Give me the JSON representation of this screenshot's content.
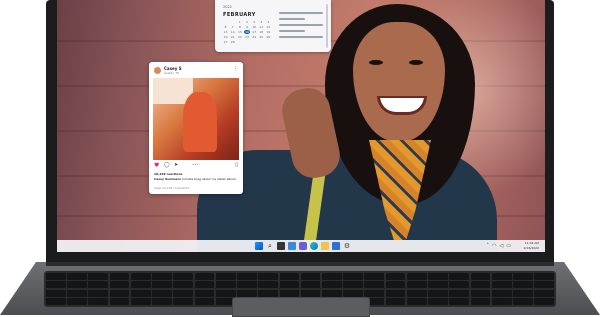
{
  "calendar_widget": {
    "year": "2022",
    "month": "FEBRUARY",
    "days": [
      "",
      "",
      "1",
      "2",
      "3",
      "4",
      "5",
      "6",
      "7",
      "8",
      "9",
      "10",
      "11",
      "12",
      "13",
      "14",
      "15",
      "16",
      "17",
      "18",
      "19",
      "20",
      "21",
      "22",
      "23",
      "24",
      "25",
      "26",
      "27",
      "28"
    ],
    "today": "16"
  },
  "social_post": {
    "username": "Casey S",
    "location": "Austin, TX",
    "likes": "10,228 reactions",
    "caption_user": "Casey Summers",
    "caption": "humble brag about my latest album",
    "comments": "View all 128 comments"
  },
  "taskbar": {
    "icons": [
      "start-icon",
      "search-icon",
      "task-view-icon",
      "widgets-icon",
      "chat-icon",
      "edge-icon",
      "file-explorer-icon",
      "store-icon",
      "settings-icon"
    ],
    "time": "11:04 AM",
    "date": "2/16/2022"
  },
  "colors": {
    "accent": "#0067c0",
    "like": "#e0245e"
  }
}
